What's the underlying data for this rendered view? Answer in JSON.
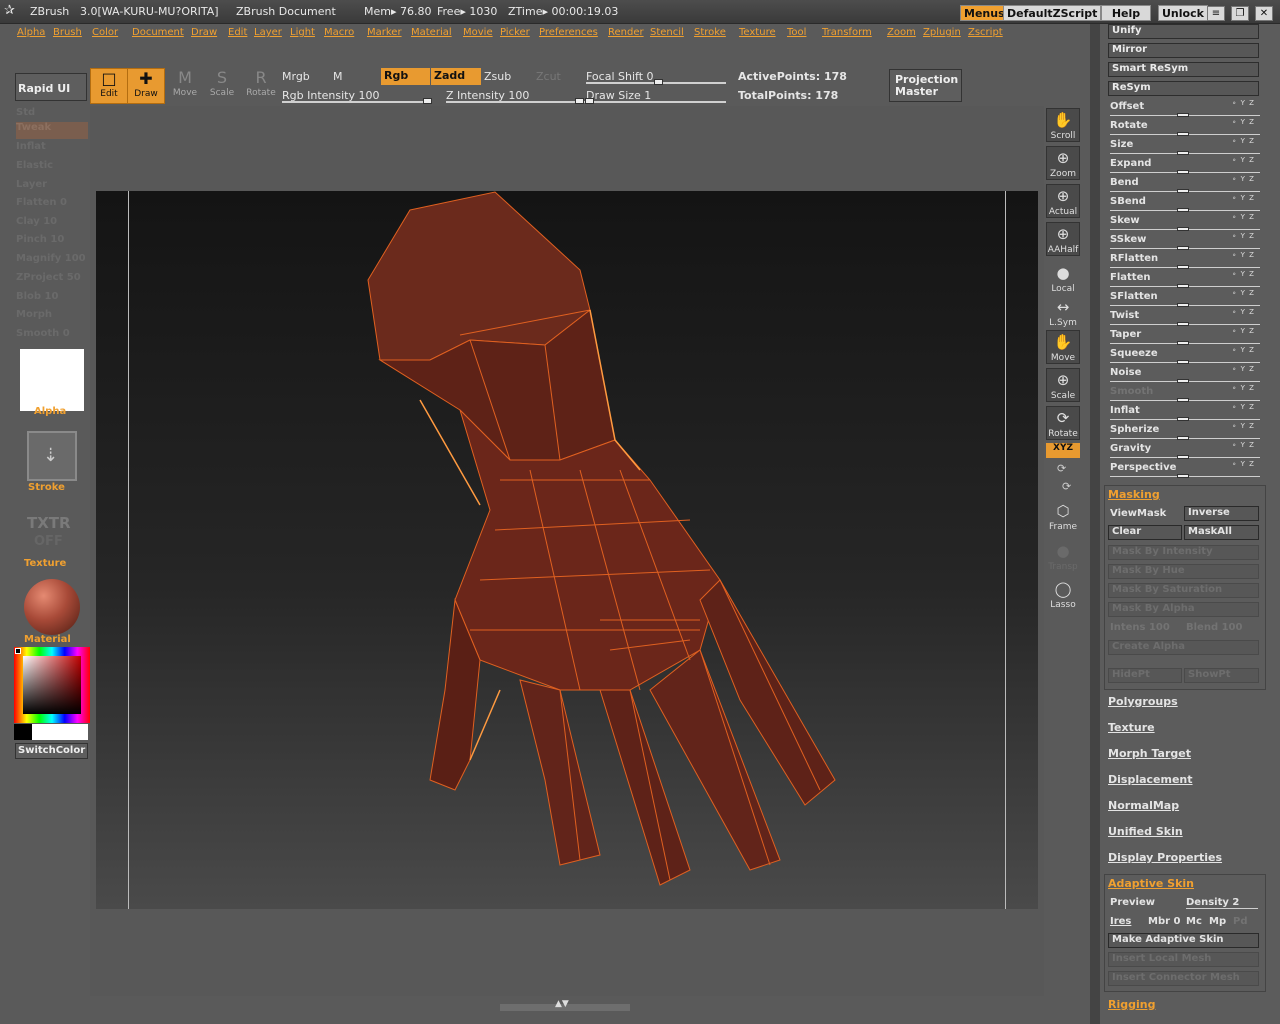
{
  "titlebar": {
    "app_name": "ZBrush",
    "version": "3.0[WA-KURU-MU?ORITA]",
    "document": "ZBrush Document",
    "mem": "Mem▸ 76.80",
    "free": "Free▸ 1030",
    "ztime": "ZTime▸ 00:00:19.03",
    "menus_btn": "Menus",
    "script_btn": "DefaultZScript",
    "help_btn": "Help",
    "unlock_btn": "Unlock"
  },
  "menubar": [
    "Alpha",
    "Brush",
    "Color",
    "Document",
    "Draw",
    "Edit",
    "Layer",
    "Light",
    "Macro",
    "Marker",
    "Material",
    "Movie",
    "Picker",
    "Preferences",
    "Render",
    "Stencil",
    "Stroke",
    "Texture",
    "Tool",
    "Transform",
    "Zoom",
    "Zplugin",
    "Zscript"
  ],
  "toolbar": {
    "rapid_ui": "Rapid UI",
    "edit": "Edit",
    "draw": "Draw",
    "move": "Move",
    "scale": "Scale",
    "rotate": "Rotate",
    "mrgb": "Mrgb",
    "m": "M",
    "rgb": "Rgb",
    "zadd": "Zadd",
    "zsub": "Zsub",
    "zcut": "Zcut",
    "rgb_intensity": "Rgb  Intensity 100",
    "z_intensity": "Z  Intensity 100",
    "focal_shift": "Focal  Shift 0",
    "draw_size": "Draw  Size 1",
    "active_points": "ActivePoints: 178",
    "total_points": "TotalPoints: 178",
    "projection_master": "Projection Master"
  },
  "left_panel": {
    "brushes": [
      "Std",
      "Tweak",
      "Inflat",
      "Elastic",
      "Layer",
      "Flatten 0",
      "Clay 10",
      "Pinch 10",
      "Magnify 100",
      "ZProject 50",
      "Blob 10",
      "Morph",
      "Smooth 0"
    ],
    "alpha_label": "Alpha",
    "stroke_label": "Stroke",
    "texture_txt": "TXTR",
    "texture_off": "OFF",
    "texture_label": "Texture",
    "material_label": "Material",
    "switch_color": "SwitchColor",
    "material_color": "#a84a38"
  },
  "right_strip": {
    "scroll": "Scroll",
    "zoom": "Zoom",
    "actual": "Actual",
    "aahalf": "AAHalf",
    "local": "Local",
    "lsym": "L.Sym",
    "move": "Move",
    "scale": "Scale",
    "rotate": "Rotate",
    "xyz": "XYZ",
    "frame": "Frame",
    "transp": "Transp",
    "lasso": "Lasso"
  },
  "deformation": {
    "buttons": [
      "Unify",
      "Mirror",
      "Smart  ReSym",
      "ReSym"
    ],
    "sliders": [
      "Offset",
      "Rotate",
      "Size",
      "Expand",
      "Bend",
      "SBend",
      "Skew",
      "SSkew",
      "RFlatten",
      "Flatten",
      "SFlatten",
      "Twist",
      "Taper",
      "Squeeze",
      "Noise",
      "Smooth",
      "Inflat",
      "Spherize",
      "Gravity",
      "Perspective"
    ]
  },
  "masking": {
    "title": "Masking",
    "view_mask": "ViewMask",
    "inverse": "Inverse",
    "clear": "Clear",
    "mask_all": "MaskAll",
    "by_intensity": "Mask  By  Intensity",
    "by_hue": "Mask  By  Hue",
    "by_saturation": "Mask  By  Saturation",
    "by_alpha": "Mask  By  Alpha",
    "intens": "Intens 100",
    "blend": "Blend 100",
    "create_alpha": "Create  Alpha",
    "hidept": "HidePt",
    "showpt": "ShowPt"
  },
  "sections": [
    "Polygroups",
    "Texture",
    "Morph  Target",
    "Displacement",
    "NormalMap",
    "Unified  Skin",
    "Display  Properties"
  ],
  "adaptive_skin": {
    "title": "Adaptive  Skin",
    "preview": "Preview",
    "density": "Density 2",
    "ires": "Ires",
    "mbr": "Mbr 0",
    "mc": "Mc",
    "mp": "Mp",
    "pd": "Pd",
    "make": "Make  Adaptive  Skin",
    "insert_local": "Insert  Local  Mesh",
    "insert_connector": "Insert  Connector  Mesh"
  },
  "rigging": "Rigging",
  "colors": {
    "accent": "#f0a030",
    "mesh_fill": "#6b261a",
    "wire": "#e06020"
  }
}
